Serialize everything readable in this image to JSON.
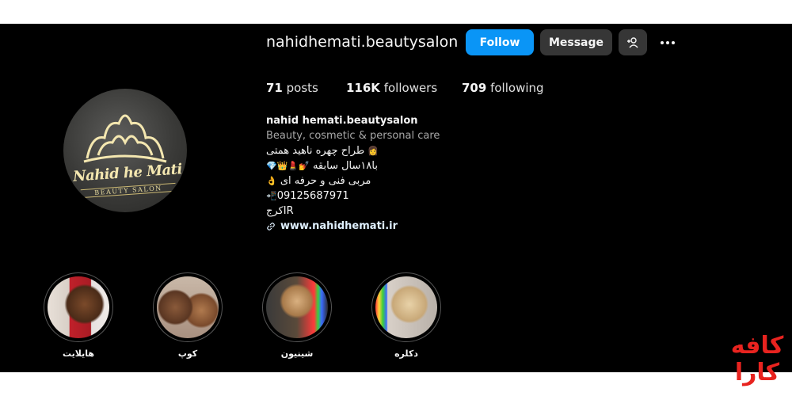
{
  "profile": {
    "username": "nahidhemati.beautysalon",
    "avatar_logo_text": "Nahid he Mati",
    "avatar_logo_sub": "BEAUTY SALON"
  },
  "actions": {
    "follow_label": "Follow",
    "message_label": "Message",
    "add_user_icon": "add-user-icon",
    "more_icon": "more-options-icon"
  },
  "stats": {
    "posts_count": "71",
    "posts_label": "posts",
    "followers_count": "116K",
    "followers_label": "followers",
    "following_count": "709",
    "following_label": "following"
  },
  "bio": {
    "name": "nahid hemati.beautysalon",
    "category": "Beauty, cosmetic & personal care",
    "line1": "طراح چهره ناهید همتی",
    "line2": "با۱۸سال سابقه",
    "line3": "مربی فنی و حرفه ای",
    "phone": "09125687971",
    "line5": "کرجIR",
    "website": "www.nahidhemati.ir"
  },
  "highlights": [
    {
      "label": "هایلایت"
    },
    {
      "label": "کوپ"
    },
    {
      "label": "شینیون"
    },
    {
      "label": "دکلره"
    }
  ],
  "watermark": {
    "line1": "کافه",
    "line2": "کارا"
  },
  "colors": {
    "follow_button": "#0a95f6",
    "secondary_button": "#363636",
    "background": "#000000",
    "watermark": "#e8231f"
  }
}
